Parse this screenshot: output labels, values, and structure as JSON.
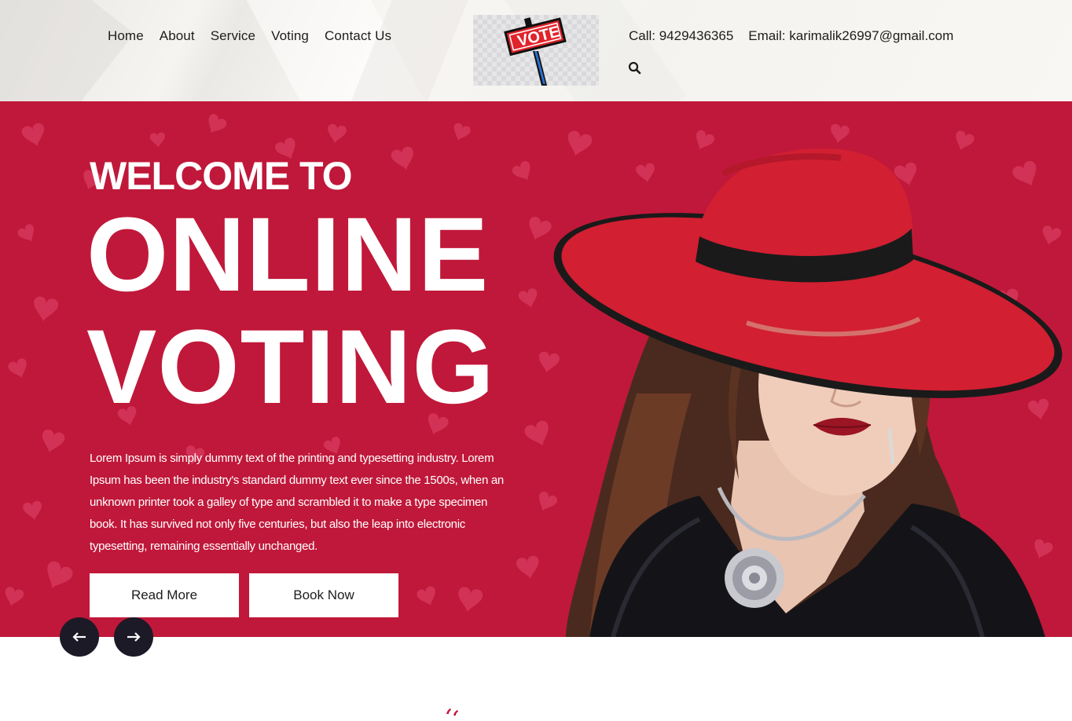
{
  "nav": {
    "items": [
      "Home",
      "About",
      "Service",
      "Voting",
      "Contact Us"
    ]
  },
  "logo": {
    "sign_text": "VOTE"
  },
  "contact": {
    "phone": "Call: 9429436365",
    "email": "Email: karimalik26997@gmail.com"
  },
  "icons": {
    "search": "search-icon",
    "prev": "arrow-left-icon",
    "next": "arrow-right-icon",
    "quote": "quote-icon"
  },
  "hero": {
    "welcome": "WELCOME TO",
    "title_line1": "ONLINE",
    "title_line2": "VOTING",
    "description": "Lorem Ipsum is simply dummy text of the printing and typesetting industry. Lorem Ipsum has been the industry's standard dummy text ever since the 1500s, when an unknown printer took a galley of type and scrambled it to make a type specimen book. It has survived not only five centuries, but also the leap into electronic typesetting, remaining essentially unchanged.",
    "read_more": "Read More",
    "book_now": "Book Now"
  },
  "colors": {
    "hero_bg": "#c0183a",
    "arrow_bg": "#1c1a26",
    "text_dark": "#1d1d1d",
    "sign_red": "#e1232b",
    "hat_red": "#d21f32"
  }
}
